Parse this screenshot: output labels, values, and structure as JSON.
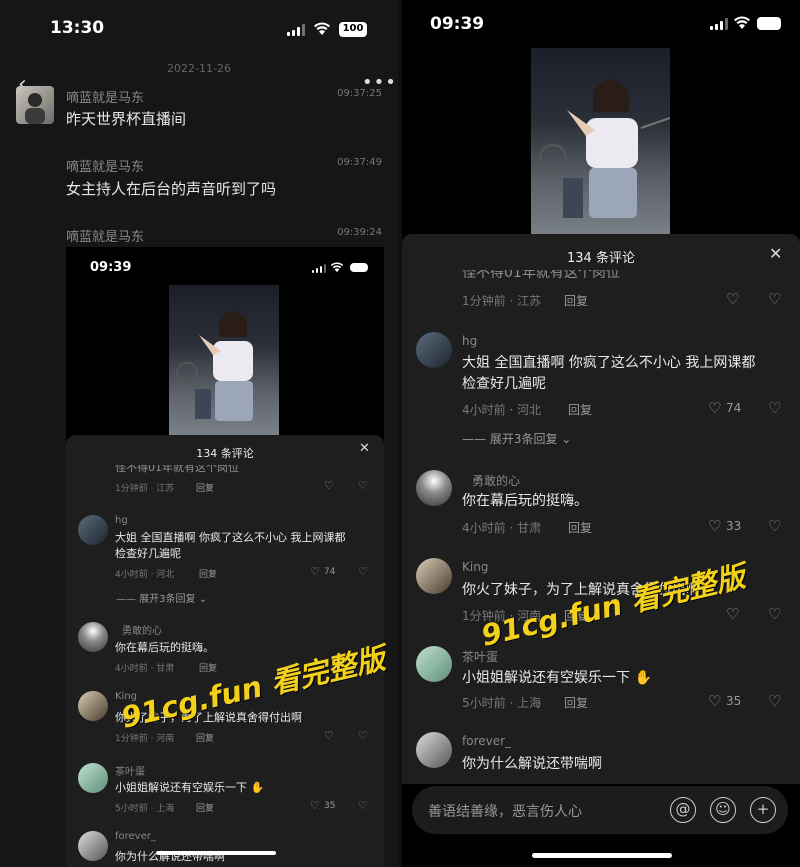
{
  "left": {
    "status_time": "13:30",
    "battery": "100",
    "date": "2022-11-26",
    "messages": [
      {
        "name": "嘀蓝就是马东",
        "time": "09:37:25",
        "text": "昨天世界杯直播间"
      },
      {
        "name": "嘀蓝就是马东",
        "time": "09:37:49",
        "text": "女主持人在后台的声音听到了吗"
      },
      {
        "name": "嘀蓝就是马东",
        "time": "09:39:24"
      }
    ],
    "shot": {
      "status_time": "09:39",
      "sheet_title": "134 条评论",
      "clipped_top": "怪不得01年就有这个岗位",
      "comments": [
        {
          "meta": "1分钟前 · 江苏",
          "reply": "回复"
        },
        {
          "name": "hg",
          "text1": "大姐 全国直播啊 你疯了这么不小心 我上网课都",
          "text2": "检查好几遍呢",
          "meta": "4小时前 · 河北",
          "reply": "回复",
          "likes": "74"
        },
        {
          "expand": "展开3条回复"
        },
        {
          "name": "勇敢的心",
          "text1": "你在幕后玩的挺嗨。",
          "meta": "4小时前 · 甘肃",
          "reply": "回复"
        },
        {
          "name": "King",
          "text1": "你火了妹子，为了上解说真舍得付出啊",
          "meta": "1分钟前 · 河南",
          "reply": "回复"
        },
        {
          "name": "茶叶蛋",
          "text1": "小姐姐解说还有空娱乐一下",
          "meta": "5小时前 · 上海",
          "reply": "回复",
          "likes": "35"
        },
        {
          "name": "forever_",
          "text1": "你为什么解说还带喘啊"
        }
      ]
    }
  },
  "right": {
    "status_time": "09:39",
    "sheet_title": "134 条评论",
    "clipped_top": "怪不得01年就有这个岗位",
    "comments": [
      {
        "meta": "1分钟前 · 江苏",
        "reply": "回复"
      },
      {
        "name": "hg",
        "text1": "大姐 全国直播啊 你疯了这么不小心 我上网课都",
        "text2": "检查好几遍呢",
        "meta": "4小时前 · 河北",
        "reply": "回复",
        "likes": "74"
      },
      {
        "expand": "展开3条回复"
      },
      {
        "name": "勇敢的心",
        "text1": "你在幕后玩的挺嗨。",
        "meta": "4小时前 · 甘肃",
        "reply": "回复",
        "likes": "33"
      },
      {
        "name": "King",
        "text1": "你火了妹子，为了上解说真舍得付出啊",
        "meta": "1分钟前 · 河南",
        "reply": "回复"
      },
      {
        "name": "茶叶蛋",
        "text1": "小姐姐解说还有空娱乐一下",
        "meta": "5小时前 · 上海",
        "reply": "回复",
        "likes": "35"
      },
      {
        "name": "forever_",
        "text1": "你为什么解说还带喘啊"
      }
    ],
    "input_placeholder": "善语结善缘，恶言伤人心",
    "icons": [
      "at-icon",
      "emoji-icon",
      "plus-icon"
    ]
  },
  "watermark": "91cg.fun 看完整版",
  "colors": {
    "watermark": "#f3d11b",
    "background": "#161616",
    "sheet": "#1e1e1e"
  }
}
